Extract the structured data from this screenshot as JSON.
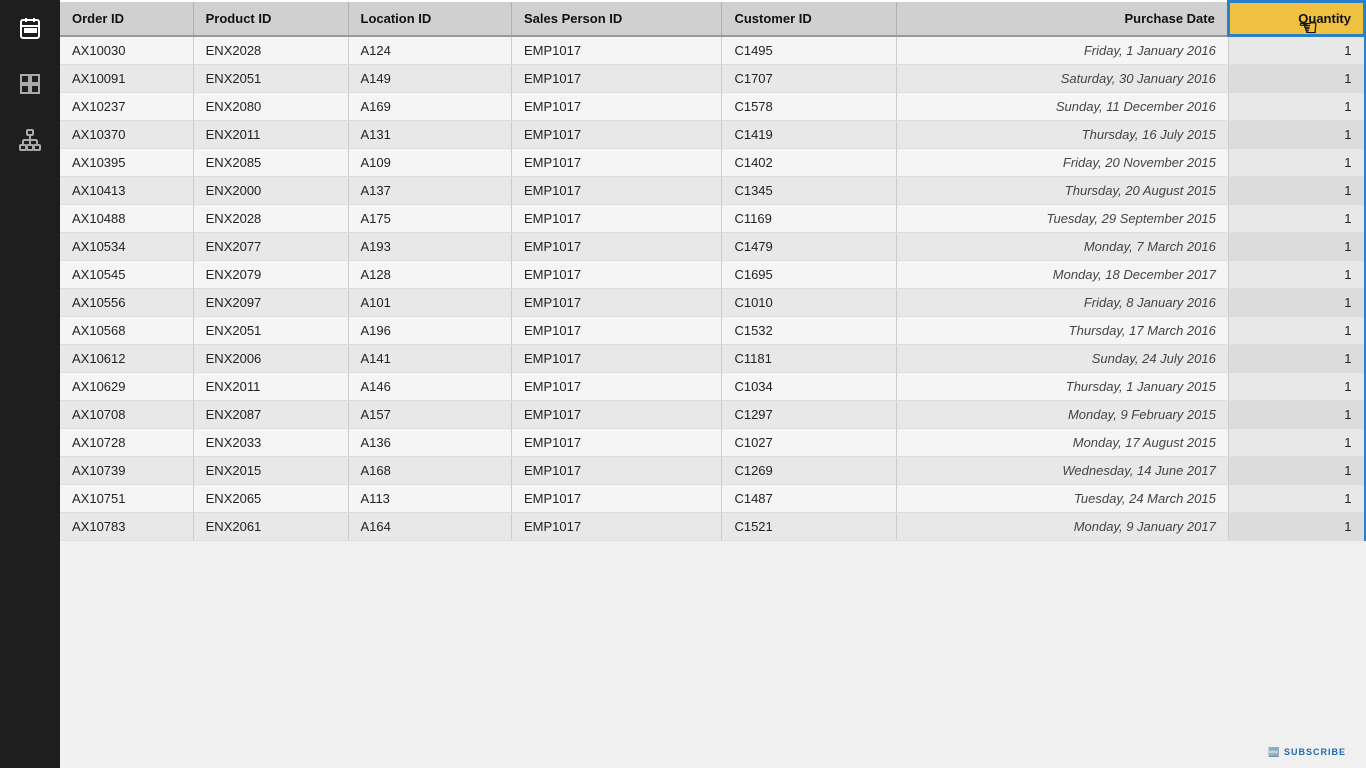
{
  "sidebar": {
    "icons": [
      {
        "name": "calendar-icon",
        "symbol": "📅"
      },
      {
        "name": "grid-icon",
        "symbol": "▦"
      },
      {
        "name": "hierarchy-icon",
        "symbol": "⬡"
      }
    ]
  },
  "table": {
    "columns": [
      {
        "key": "order_id",
        "label": "Order ID",
        "type": "text"
      },
      {
        "key": "product_id",
        "label": "Product ID",
        "type": "text"
      },
      {
        "key": "location_id",
        "label": "Location ID",
        "type": "text"
      },
      {
        "key": "sales_person_id",
        "label": "Sales Person ID",
        "type": "text"
      },
      {
        "key": "customer_id",
        "label": "Customer ID",
        "type": "text"
      },
      {
        "key": "purchase_date",
        "label": "Purchase Date",
        "type": "date"
      },
      {
        "key": "quantity",
        "label": "Quantity",
        "type": "number"
      }
    ],
    "rows": [
      {
        "order_id": "AX10030",
        "product_id": "ENX2028",
        "location_id": "A124",
        "sales_person_id": "EMP1017",
        "customer_id": "C1495",
        "purchase_date": "Friday, 1 January 2016",
        "quantity": "1"
      },
      {
        "order_id": "AX10091",
        "product_id": "ENX2051",
        "location_id": "A149",
        "sales_person_id": "EMP1017",
        "customer_id": "C1707",
        "purchase_date": "Saturday, 30 January 2016",
        "quantity": "1"
      },
      {
        "order_id": "AX10237",
        "product_id": "ENX2080",
        "location_id": "A169",
        "sales_person_id": "EMP1017",
        "customer_id": "C1578",
        "purchase_date": "Sunday, 11 December 2016",
        "quantity": "1"
      },
      {
        "order_id": "AX10370",
        "product_id": "ENX2011",
        "location_id": "A131",
        "sales_person_id": "EMP1017",
        "customer_id": "C1419",
        "purchase_date": "Thursday, 16 July 2015",
        "quantity": "1"
      },
      {
        "order_id": "AX10395",
        "product_id": "ENX2085",
        "location_id": "A109",
        "sales_person_id": "EMP1017",
        "customer_id": "C1402",
        "purchase_date": "Friday, 20 November 2015",
        "quantity": "1"
      },
      {
        "order_id": "AX10413",
        "product_id": "ENX2000",
        "location_id": "A137",
        "sales_person_id": "EMP1017",
        "customer_id": "C1345",
        "purchase_date": "Thursday, 20 August 2015",
        "quantity": "1"
      },
      {
        "order_id": "AX10488",
        "product_id": "ENX2028",
        "location_id": "A175",
        "sales_person_id": "EMP1017",
        "customer_id": "C1169",
        "purchase_date": "Tuesday, 29 September 2015",
        "quantity": "1"
      },
      {
        "order_id": "AX10534",
        "product_id": "ENX2077",
        "location_id": "A193",
        "sales_person_id": "EMP1017",
        "customer_id": "C1479",
        "purchase_date": "Monday, 7 March 2016",
        "quantity": "1"
      },
      {
        "order_id": "AX10545",
        "product_id": "ENX2079",
        "location_id": "A128",
        "sales_person_id": "EMP1017",
        "customer_id": "C1695",
        "purchase_date": "Monday, 18 December 2017",
        "quantity": "1"
      },
      {
        "order_id": "AX10556",
        "product_id": "ENX2097",
        "location_id": "A101",
        "sales_person_id": "EMP1017",
        "customer_id": "C1010",
        "purchase_date": "Friday, 8 January 2016",
        "quantity": "1"
      },
      {
        "order_id": "AX10568",
        "product_id": "ENX2051",
        "location_id": "A196",
        "sales_person_id": "EMP1017",
        "customer_id": "C1532",
        "purchase_date": "Thursday, 17 March 2016",
        "quantity": "1"
      },
      {
        "order_id": "AX10612",
        "product_id": "ENX2006",
        "location_id": "A141",
        "sales_person_id": "EMP1017",
        "customer_id": "C1181",
        "purchase_date": "Sunday, 24 July 2016",
        "quantity": "1"
      },
      {
        "order_id": "AX10629",
        "product_id": "ENX2011",
        "location_id": "A146",
        "sales_person_id": "EMP1017",
        "customer_id": "C1034",
        "purchase_date": "Thursday, 1 January 2015",
        "quantity": "1"
      },
      {
        "order_id": "AX10708",
        "product_id": "ENX2087",
        "location_id": "A157",
        "sales_person_id": "EMP1017",
        "customer_id": "C1297",
        "purchase_date": "Monday, 9 February 2015",
        "quantity": "1"
      },
      {
        "order_id": "AX10728",
        "product_id": "ENX2033",
        "location_id": "A136",
        "sales_person_id": "EMP1017",
        "customer_id": "C1027",
        "purchase_date": "Monday, 17 August 2015",
        "quantity": "1"
      },
      {
        "order_id": "AX10739",
        "product_id": "ENX2015",
        "location_id": "A168",
        "sales_person_id": "EMP1017",
        "customer_id": "C1269",
        "purchase_date": "Wednesday, 14 June 2017",
        "quantity": "1"
      },
      {
        "order_id": "AX10751",
        "product_id": "ENX2065",
        "location_id": "A113",
        "sales_person_id": "EMP1017",
        "customer_id": "C1487",
        "purchase_date": "Tuesday, 24 March 2015",
        "quantity": "1"
      },
      {
        "order_id": "AX10783",
        "product_id": "ENX2061",
        "location_id": "A164",
        "sales_person_id": "EMP1017",
        "customer_id": "C1521",
        "purchase_date": "Monday, 9 January 2017",
        "quantity": "1"
      }
    ]
  },
  "watermark": {
    "text": "SUBSCRIBE"
  }
}
